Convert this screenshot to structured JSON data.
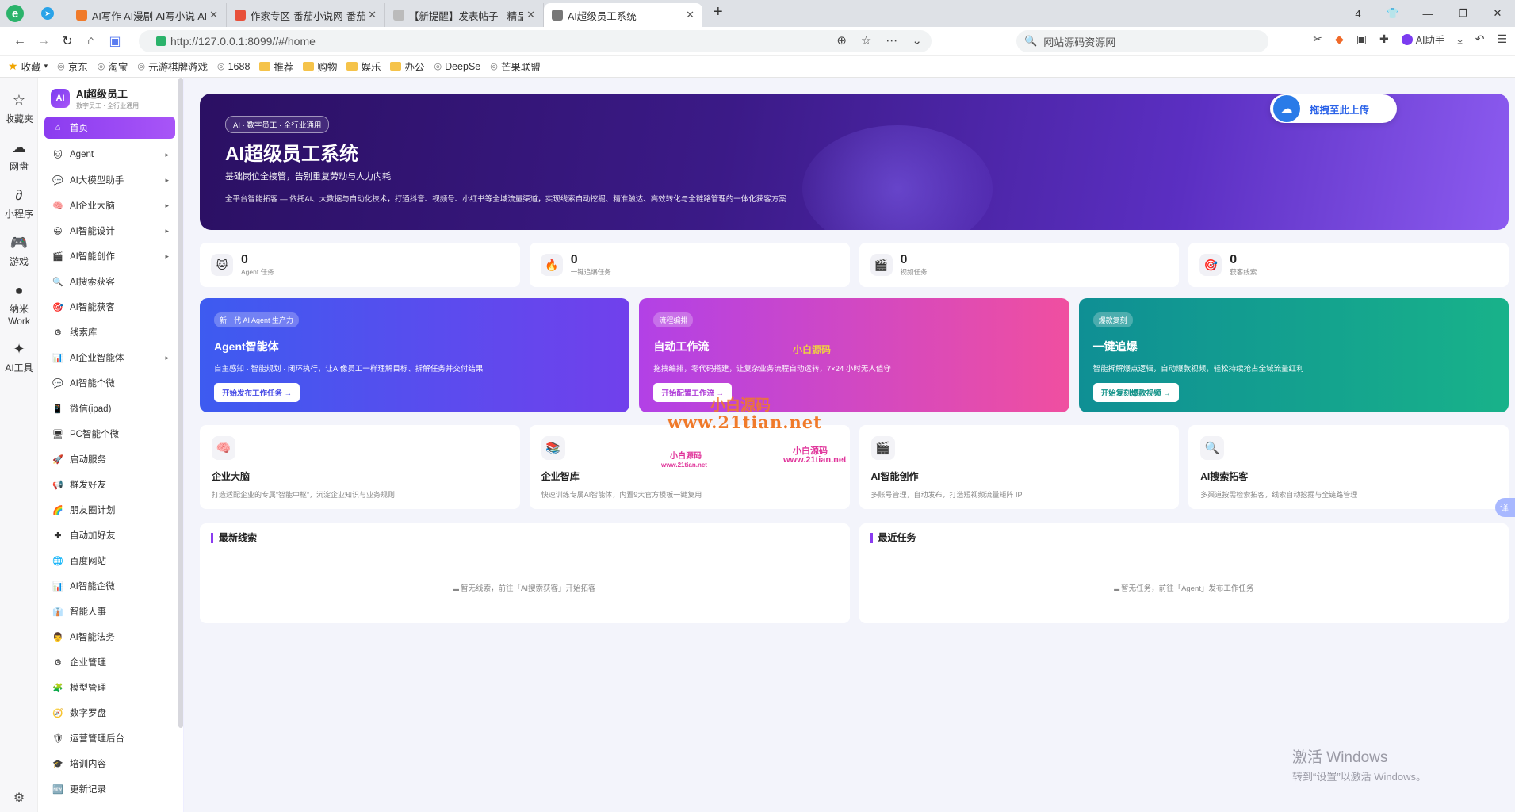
{
  "browser": {
    "tabs": [
      {
        "title": "AI写作 AI漫剧 AI写小说 AI",
        "color": "#f07a2a",
        "active": false
      },
      {
        "title": "作家专区-番茄小说网-番茄小",
        "color": "#e8503a",
        "active": false
      },
      {
        "title": "【新提醒】发表帖子 - 精品",
        "color": "#bbbbbb",
        "active": false
      },
      {
        "title": "AI超级员工系统",
        "color": "#777777",
        "active": true
      }
    ],
    "tab_count": "4",
    "url": "http://127.0.0.1:8099//#/home",
    "search_placeholder": "网站源码资源网",
    "ai_helper": "AI助手"
  },
  "bookmarks": [
    "收藏",
    "京东",
    "淘宝",
    "元游棋牌游戏",
    "1688",
    "推荐",
    "购物",
    "娱乐",
    "办公",
    "DeepSe",
    "芒果联盟"
  ],
  "left_strip": [
    {
      "icon": "☆",
      "label": "收藏夹"
    },
    {
      "icon": "☁",
      "label": "网盘"
    },
    {
      "icon": "∂",
      "label": "小程序"
    },
    {
      "icon": "🎮",
      "label": "游戏"
    },
    {
      "icon": "●",
      "label": "纳米Work"
    },
    {
      "icon": "✦",
      "label": "AI工具"
    }
  ],
  "sidebar": {
    "logo": "AI",
    "title": "AI超级员工",
    "subtitle": "数字员工 · 全行业通用",
    "items": [
      {
        "icon": "⌂",
        "label": "首页",
        "arrow": false
      },
      {
        "icon": "🐱",
        "label": "Agent",
        "arrow": true
      },
      {
        "icon": "💬",
        "label": "AI大模型助手",
        "arrow": true
      },
      {
        "icon": "🧠",
        "label": "AI企业大脑",
        "arrow": true
      },
      {
        "icon": "😃",
        "label": "AI智能设计",
        "arrow": true
      },
      {
        "icon": "🎬",
        "label": "AI智能创作",
        "arrow": true
      },
      {
        "icon": "🔍",
        "label": "AI搜索获客",
        "arrow": false
      },
      {
        "icon": "🎯",
        "label": "AI智能获客",
        "arrow": false
      },
      {
        "icon": "⚙",
        "label": "线索库",
        "arrow": false
      },
      {
        "icon": "📊",
        "label": "AI企业智能体",
        "arrow": true
      },
      {
        "icon": "💬",
        "label": "AI智能个微",
        "arrow": false
      },
      {
        "icon": "📱",
        "label": "微信(ipad)",
        "arrow": false
      },
      {
        "icon": "🖥",
        "label": "PC智能个微",
        "arrow": false
      },
      {
        "icon": "🚀",
        "label": "启动服务",
        "arrow": false
      },
      {
        "icon": "📢",
        "label": "群发好友",
        "arrow": false
      },
      {
        "icon": "🌈",
        "label": "朋友圈计划",
        "arrow": false
      },
      {
        "icon": "✚",
        "label": "自动加好友",
        "arrow": false
      },
      {
        "icon": "🌐",
        "label": "百度网站",
        "arrow": false
      },
      {
        "icon": "📊",
        "label": "AI智能企微",
        "arrow": false
      },
      {
        "icon": "👔",
        "label": "智能人事",
        "arrow": false
      },
      {
        "icon": "👨",
        "label": "AI智能法务",
        "arrow": false
      },
      {
        "icon": "⚙",
        "label": "企业管理",
        "arrow": false
      },
      {
        "icon": "🧩",
        "label": "模型管理",
        "arrow": false
      },
      {
        "icon": "🧭",
        "label": "数字罗盘",
        "arrow": false
      },
      {
        "icon": "🛡",
        "label": "运营管理后台",
        "arrow": false
      },
      {
        "icon": "🎓",
        "label": "培训内容",
        "arrow": false
      },
      {
        "icon": "🆕",
        "label": "更新记录",
        "arrow": false
      }
    ]
  },
  "hero": {
    "pill": "AI · 数字员工 · 全行业通用",
    "title": "AI超级员工系统",
    "subtitle": "基础岗位全接管，告别重复劳动与人力内耗",
    "desc": "全平台智能拓客 — 依托AI、大数据与自动化技术，打通抖音、视频号、小红书等全域流量渠道，实现线索自动挖掘、精准触达、高效转化与全链路管理的一体化获客方案",
    "upload": "拖拽至此上传"
  },
  "stats": [
    {
      "icon": "🐱",
      "value": "0",
      "label": "Agent 任务"
    },
    {
      "icon": "🔥",
      "value": "0",
      "label": "一键追爆任务"
    },
    {
      "icon": "🎬",
      "value": "0",
      "label": "视频任务"
    },
    {
      "icon": "🎯",
      "value": "0",
      "label": "获客线索"
    }
  ],
  "features": [
    {
      "pill": "新一代 AI Agent 生产力",
      "title": "Agent智能体",
      "desc": "自主感知 · 智能规划 · 闭环执行，让AI像员工一样理解目标、拆解任务并交付结果",
      "button": "开始发布工作任务 →"
    },
    {
      "pill": "流程编排",
      "title": "自动工作流",
      "desc": "拖拽编排，零代码搭建，让复杂业务流程自动运转，7×24 小时无人值守",
      "button": "开始配置工作流 →"
    },
    {
      "pill": "爆款复刻",
      "title": "一键追爆",
      "desc": "智能拆解爆点逻辑，自动爆款视频，轻松持续抢占全域流量红利",
      "button": "开始复刻爆款视频 →"
    }
  ],
  "modules": [
    {
      "icon": "🧠",
      "title": "企业大脑",
      "desc": "打造适配企业的专属“智能中枢”，沉淀企业知识与业务规则"
    },
    {
      "icon": "📚",
      "title": "企业智库",
      "desc": "快速训练专属AI智能体，内置9大官方模板一键复用"
    },
    {
      "icon": "🎬",
      "title": "AI智能创作",
      "desc": "多账号管理，自动发布，打造短视频流量矩阵 IP"
    },
    {
      "icon": "🔍",
      "title": "AI搜索拓客",
      "desc": "多渠道按需检索拓客，线索自动挖掘与全链路管理"
    }
  ],
  "panels": [
    {
      "title": "最新线索",
      "empty": "暂无线索，前往「AI搜索获客」开始拓客"
    },
    {
      "title": "最近任务",
      "empty": "暂无任务，前往「Agent」发布工作任务"
    }
  ],
  "overlay_marks": [
    "小白源码",
    "www.21tian.net",
    "小白源码",
    "小白源码",
    "www.21tian.net",
    "小白源码",
    "www.21tian.net"
  ],
  "watermark": {
    "line1": "激活 Windows",
    "line2": "转到“设置”以激活 Windows。"
  },
  "translate_label": "译"
}
